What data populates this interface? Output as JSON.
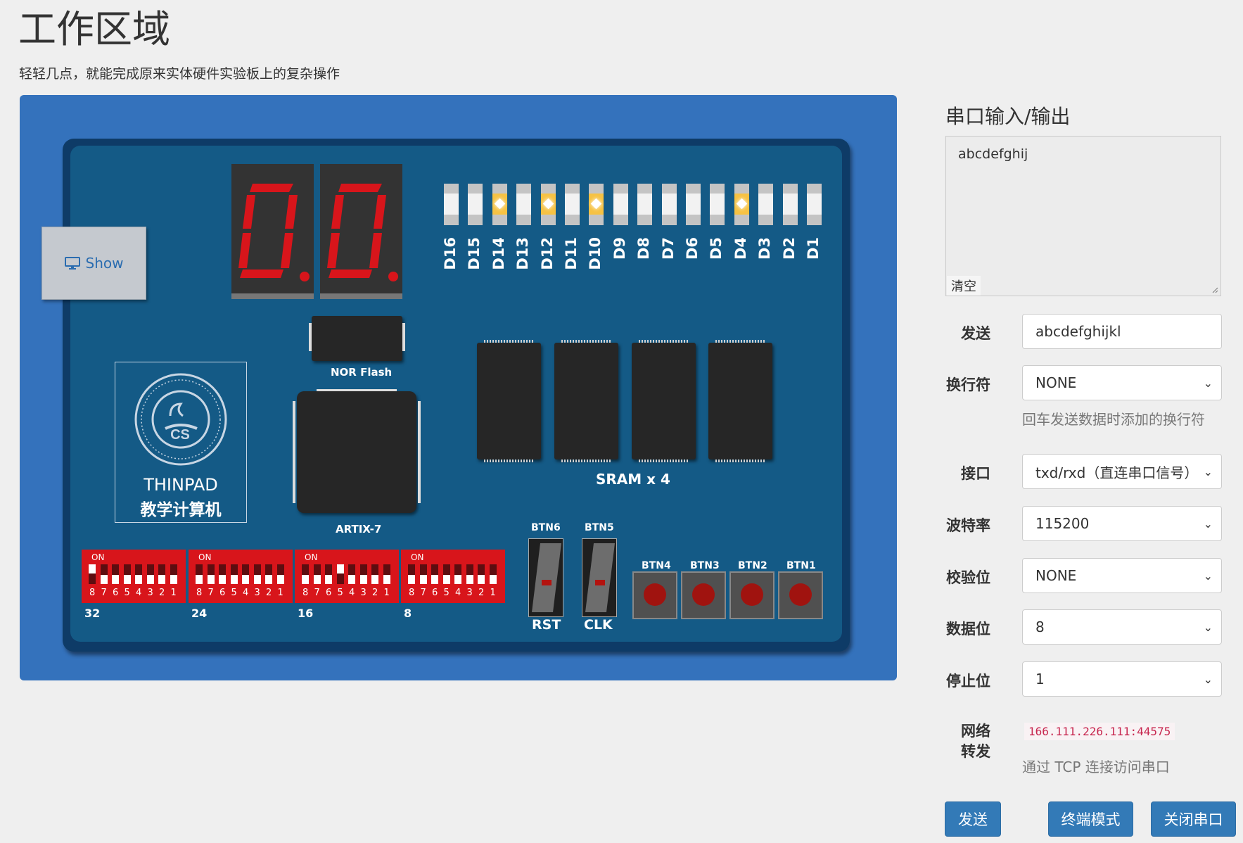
{
  "header": {
    "title": "工作区域",
    "subtitle": "轻轻几点，就能完成原来实体硬件实验板上的复杂操作"
  },
  "board": {
    "show_button": "Show",
    "leds": [
      {
        "label": "D16",
        "on": false
      },
      {
        "label": "D15",
        "on": false
      },
      {
        "label": "D14",
        "on": true
      },
      {
        "label": "D13",
        "on": false
      },
      {
        "label": "D12",
        "on": true
      },
      {
        "label": "D11",
        "on": false
      },
      {
        "label": "D10",
        "on": true
      },
      {
        "label": "D9",
        "on": false
      },
      {
        "label": "D8",
        "on": false
      },
      {
        "label": "D7",
        "on": false
      },
      {
        "label": "D6",
        "on": false
      },
      {
        "label": "D5",
        "on": false
      },
      {
        "label": "D4",
        "on": true
      },
      {
        "label": "D3",
        "on": false
      },
      {
        "label": "D2",
        "on": false
      },
      {
        "label": "D1",
        "on": false
      }
    ],
    "nor_flash_label": "NOR Flash",
    "fpga_label": "ARTIX-7",
    "sram_label": "SRAM x 4",
    "logo": {
      "title": "THINPAD",
      "subtitle": "教学计算机"
    },
    "dip_switches": [
      {
        "on_label": "ON",
        "index_label": "32",
        "states": [
          1,
          0,
          0,
          0,
          0,
          0,
          0,
          0
        ]
      },
      {
        "on_label": "ON",
        "index_label": "24",
        "states": [
          0,
          0,
          0,
          0,
          0,
          0,
          0,
          0
        ]
      },
      {
        "on_label": "ON",
        "index_label": "16",
        "states": [
          0,
          0,
          0,
          1,
          0,
          0,
          0,
          0
        ]
      },
      {
        "on_label": "ON",
        "index_label": "8",
        "states": [
          0,
          0,
          0,
          0,
          0,
          0,
          0,
          0
        ]
      }
    ],
    "dip_numbers": [
      "8",
      "7",
      "6",
      "5",
      "4",
      "3",
      "2",
      "1"
    ],
    "toggles": [
      {
        "top_label": "BTN6",
        "bottom_label": "RST"
      },
      {
        "top_label": "BTN5",
        "bottom_label": "CLK"
      }
    ],
    "push_buttons": [
      "BTN4",
      "BTN3",
      "BTN2",
      "BTN1"
    ]
  },
  "serial": {
    "title": "串口输入/输出",
    "output_text": "abcdefghij",
    "clear_label": "清空",
    "send_label": "发送",
    "send_value": "abcdefghijkl",
    "newline_label": "换行符",
    "newline_value": "NONE",
    "newline_help": "回车发送数据时添加的换行符",
    "interface_label": "接口",
    "interface_value": "txd/rxd（直连串口信号）",
    "baud_label": "波特率",
    "baud_value": "115200",
    "parity_label": "校验位",
    "parity_value": "NONE",
    "databits_label": "数据位",
    "databits_value": "8",
    "stopbits_label": "停止位",
    "stopbits_value": "1",
    "network_label": "网络\n转发",
    "network_address": "166.111.226.111:44575",
    "network_help": "通过 TCP 连接访问串口",
    "buttons": {
      "send": "发送",
      "terminal": "终端模式",
      "close": "关闭串口"
    }
  },
  "colors": {
    "board_frame": "#3472bc",
    "board": "#145a86",
    "led_on": "#f6c243",
    "segment": "#d8151b",
    "primary": "#337ab7"
  }
}
